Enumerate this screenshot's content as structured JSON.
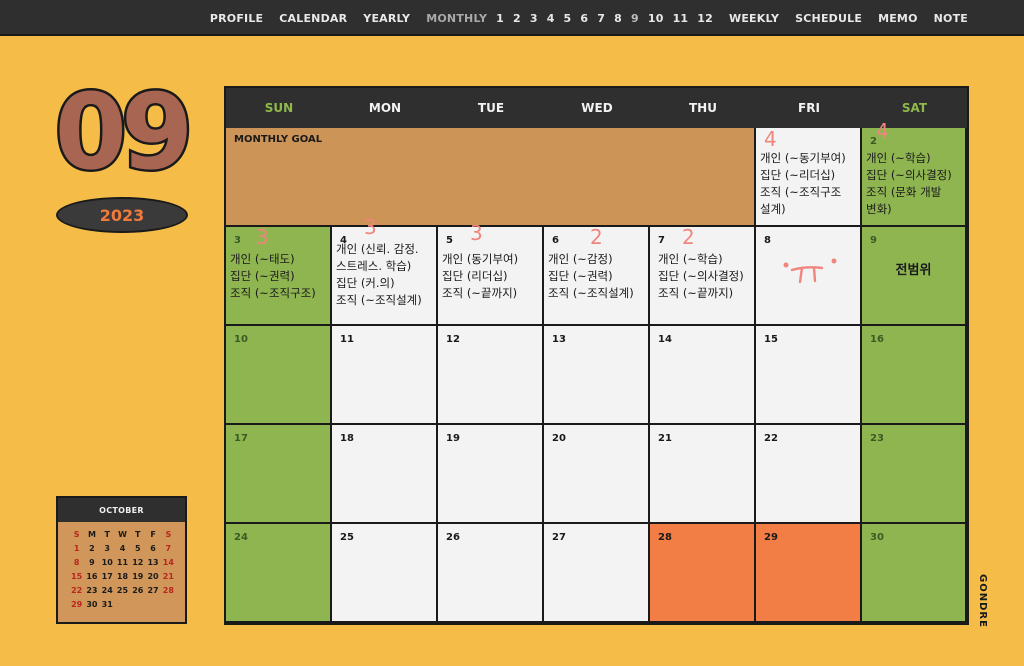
{
  "nav": {
    "items": [
      "PROFILE",
      "CALENDAR",
      "YEARLY",
      "MONTHLY"
    ],
    "months": [
      "1",
      "2",
      "3",
      "4",
      "5",
      "6",
      "7",
      "8",
      "9",
      "10",
      "11",
      "12"
    ],
    "tail": [
      "WEEKLY",
      "SCHEDULE",
      "MEMO",
      "NOTE"
    ],
    "active": "MONTHLY"
  },
  "header": {
    "month": "09",
    "year": "2023"
  },
  "mini_calendar": {
    "title": "OCTOBER",
    "weekdays": [
      "S",
      "M",
      "T",
      "W",
      "T",
      "F",
      "S"
    ],
    "weeks": [
      [
        "1",
        "2",
        "3",
        "4",
        "5",
        "6",
        "7"
      ],
      [
        "8",
        "9",
        "10",
        "11",
        "12",
        "13",
        "14"
      ],
      [
        "15",
        "16",
        "17",
        "18",
        "19",
        "20",
        "21"
      ],
      [
        "22",
        "23",
        "24",
        "25",
        "26",
        "27",
        "28"
      ],
      [
        "29",
        "30",
        "31",
        "",
        "",
        "",
        ""
      ]
    ]
  },
  "calendar": {
    "weekdays": [
      "SUN",
      "MON",
      "TUE",
      "WED",
      "THU",
      "FRI",
      "SAT"
    ],
    "goal_title": "MONTHLY GOAL",
    "days": {
      "d1": {
        "num": "",
        "events": [
          "개인 (~동기부여)",
          "집단 (~리더십)",
          "조직 (~조직구조",
          "설계)"
        ]
      },
      "d2": {
        "num": "2",
        "events": [
          "개인 (~학습)",
          "집단 (~의사결정)",
          "조직 (문화 개발",
          "변화)"
        ]
      },
      "d3": {
        "num": "3",
        "events": [
          "개인 (~태도)",
          "집단 (~권력)",
          "조직 (~조직구조)"
        ]
      },
      "d4": {
        "num": "4",
        "events": [
          "개인 (신뢰. 감정.",
          "스트레스. 학습)",
          "집단 (커.의)",
          "조직 (~조직설계)"
        ]
      },
      "d5": {
        "num": "5",
        "events": [
          "개인 (동기부여)",
          "집단 (리더십)",
          "조직 (~끝까지)"
        ]
      },
      "d6": {
        "num": "6",
        "events": [
          "개인 (~감정)",
          "집단 (~권력)",
          "조직 (~조직설계)"
        ]
      },
      "d7": {
        "num": "7",
        "events": [
          "개인 (~학습)",
          "집단 (~의사결정)",
          "조직 (~끝까지)"
        ]
      },
      "d8": {
        "num": "8",
        "events": []
      },
      "d9": {
        "num": "9",
        "center": "전범위"
      },
      "rest": [
        "10",
        "11",
        "12",
        "13",
        "14",
        "15",
        "16",
        "17",
        "18",
        "19",
        "20",
        "21",
        "22",
        "23",
        "24",
        "25",
        "26",
        "27",
        "28",
        "29",
        "30"
      ]
    },
    "handwritten": [
      "4",
      "4",
      "3",
      "3",
      "3",
      "2",
      "2"
    ],
    "colors": {
      "weekend": "#8fb551",
      "highlight": "#f27d45",
      "goal": "#cc9456",
      "background": "#f5bd48"
    }
  },
  "brand": "GONDRE"
}
